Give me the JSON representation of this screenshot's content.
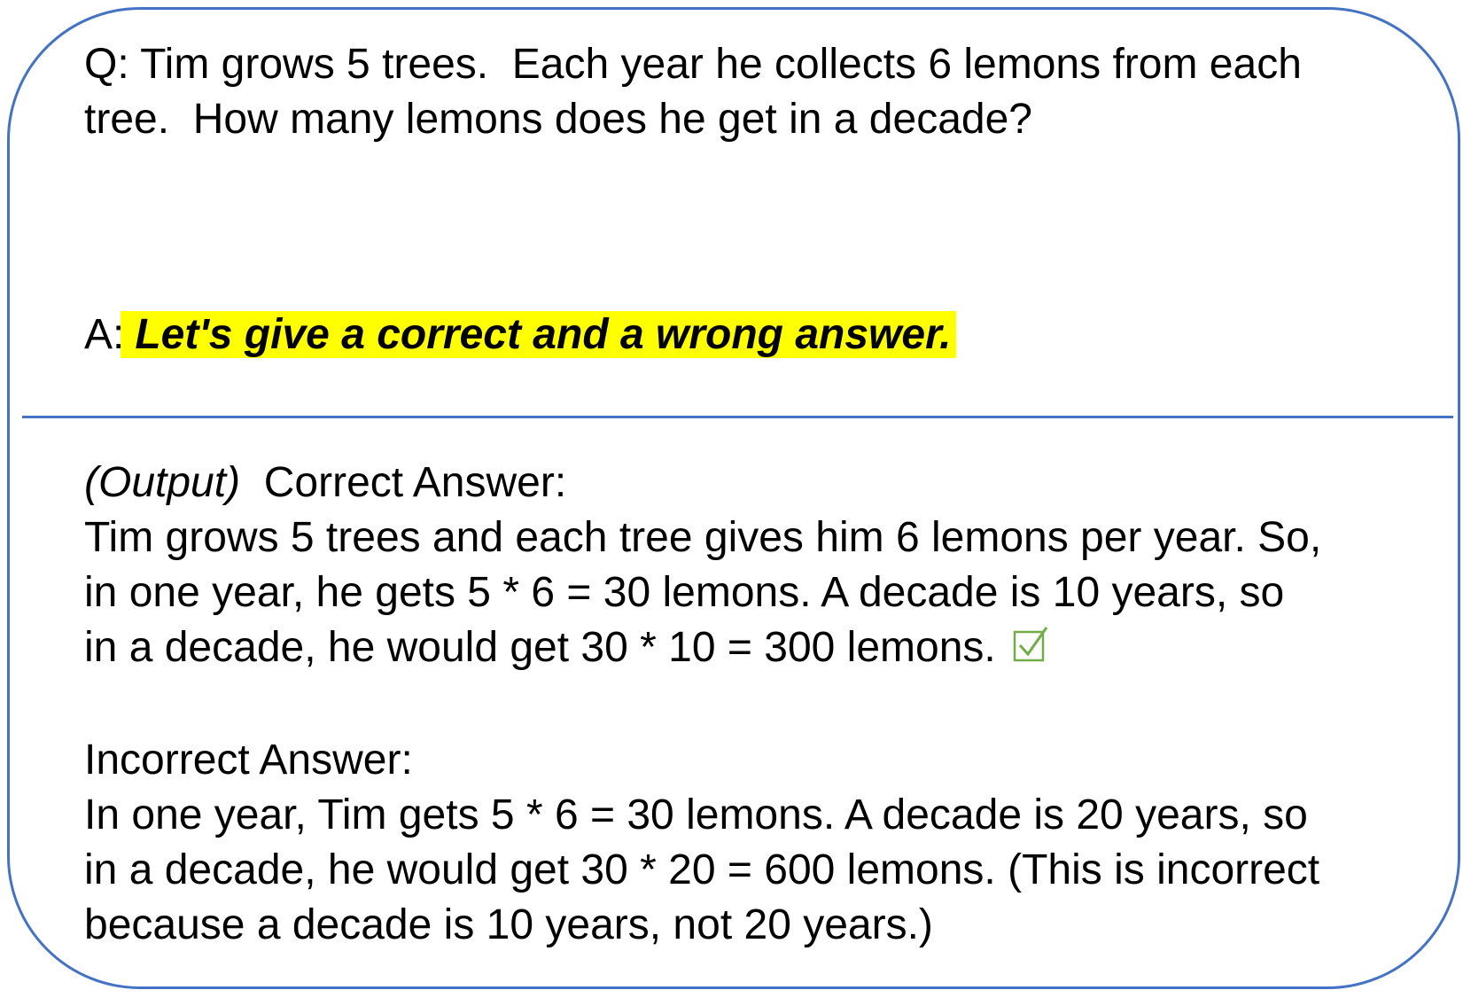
{
  "question": {
    "line1": "Q: Tim grows 5 trees.  Each year he collects 6 lemons from each",
    "line2": "tree.  How many lemons does he get in a decade?"
  },
  "answer": {
    "label": "A:",
    "prompt": "Let's give a correct and a wrong answer.",
    "highlight_color": "#ffff00"
  },
  "output": {
    "tag": "(Output)",
    "correct_heading": "Correct Answer:",
    "correct_line1": "Tim grows 5 trees and each tree gives him 6 lemons per year. So,",
    "correct_line2": "in one year, he gets 5 * 6 = 30 lemons. A decade is 10 years, so",
    "correct_line3": "in a decade, he would get 30 * 10 = 300 lemons.",
    "check_icon": "checkbox-checked-icon",
    "check_color": "#70ad47"
  },
  "incorrect": {
    "heading": "Incorrect Answer:",
    "line1": "In one year, Tim gets 5 * 6 = 30 lemons. A decade is 20 years, so",
    "line2": "in a decade, he would get 30 * 20 = 600 lemons. (This is incorrect",
    "line3": "because a decade is 10 years, not 20 years.)"
  },
  "border_color": "#4472c4"
}
